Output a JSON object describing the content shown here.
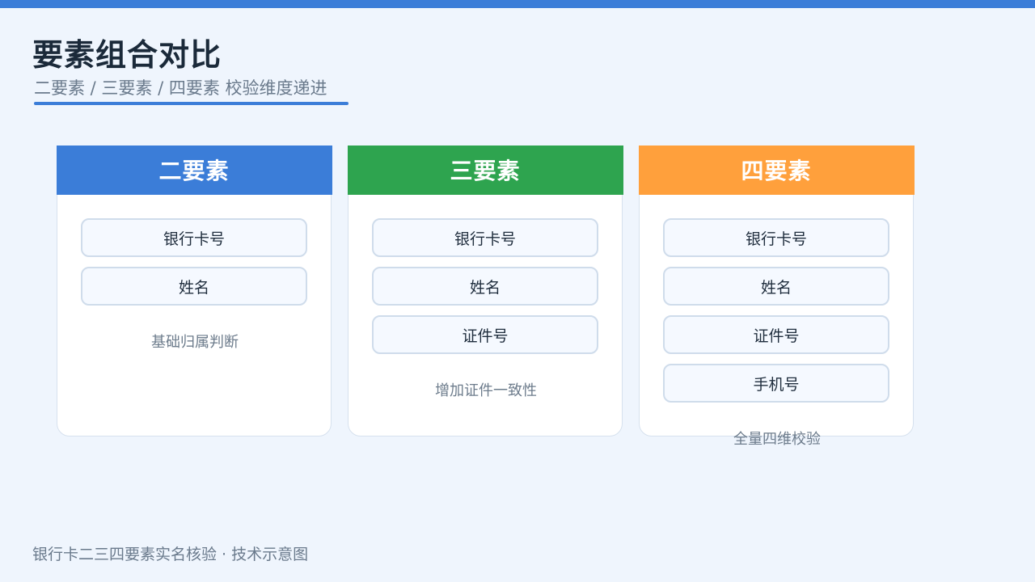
{
  "title": "要素组合对比",
  "subtitle": "二要素 / 三要素 / 四要素 校验维度递进",
  "colors": {
    "accent": "#3b7dd8",
    "two": "#3b7dd8",
    "three": "#2ea44f",
    "four": "#ffa03c"
  },
  "cards": [
    {
      "name": "二要素",
      "items": [
        "银行卡号",
        "姓名"
      ],
      "note": "基础归属判断"
    },
    {
      "name": "三要素",
      "items": [
        "银行卡号",
        "姓名",
        "证件号"
      ],
      "note": "增加证件一致性"
    },
    {
      "name": "四要素",
      "items": [
        "银行卡号",
        "姓名",
        "证件号",
        "手机号"
      ],
      "note": "全量四维校验"
    }
  ],
  "footer": "银行卡二三四要素实名核验 · 技术示意图"
}
